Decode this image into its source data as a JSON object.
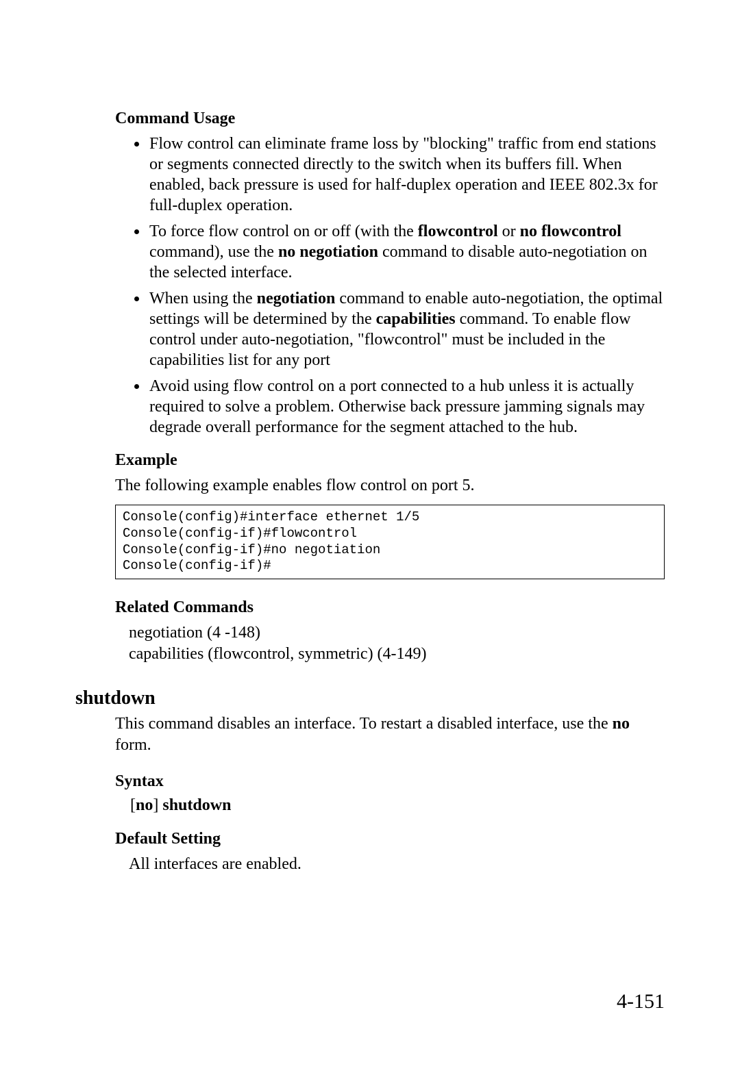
{
  "headings": {
    "command_usage": "Command Usage",
    "example": "Example",
    "related_commands": "Related Commands",
    "syntax": "Syntax",
    "default_setting": "Default Setting"
  },
  "bullets": {
    "b1": "Flow control can eliminate frame loss by \"blocking\" traffic from end stations or segments connected directly to the switch when its buffers fill. When enabled, back pressure is used for half-duplex operation and IEEE 802.3x for full-duplex operation.",
    "b2_p1": "To force flow control on or off (with the ",
    "b2_k1": "flowcontrol",
    "b2_p2": " or ",
    "b2_k2": "no flowcontrol",
    "b2_p3": " command), use the ",
    "b2_k3": "no negotiation",
    "b2_p4": " command to disable auto-negotiation on the selected interface.",
    "b3_p1": "When using the ",
    "b3_k1": "negotiation",
    "b3_p2": " command to enable auto-negotiation, the optimal settings will be determined by the ",
    "b3_k2": "capabilities",
    "b3_p3": " command. To enable flow control under auto-negotiation, \"flowcontrol\" must be included in the capabilities list for any port",
    "b4": "Avoid using flow control on a port connected to a hub unless it is actually required to solve a problem. Otherwise back pressure jamming signals may degrade overall performance for the segment attached to the hub."
  },
  "example_intro": "The following example enables flow control on port 5.",
  "code": "Console(config)#interface ethernet 1/5\nConsole(config-if)#flowcontrol\nConsole(config-if)#no negotiation\nConsole(config-if)#",
  "related": {
    "r1": "negotiation (4 -148)",
    "r2": "capabilities (flowcontrol, symmetric) (4-149)"
  },
  "shutdown": {
    "title": "shutdown",
    "desc_p1": "This command disables an interface. To restart a disabled interface, use the ",
    "desc_k1": "no",
    "desc_p2": " form.",
    "syntax_p1": "[",
    "syntax_k1": "no",
    "syntax_p2": "] ",
    "syntax_k2": "shutdown",
    "default": "All interfaces are enabled."
  },
  "page_number": "4-151"
}
